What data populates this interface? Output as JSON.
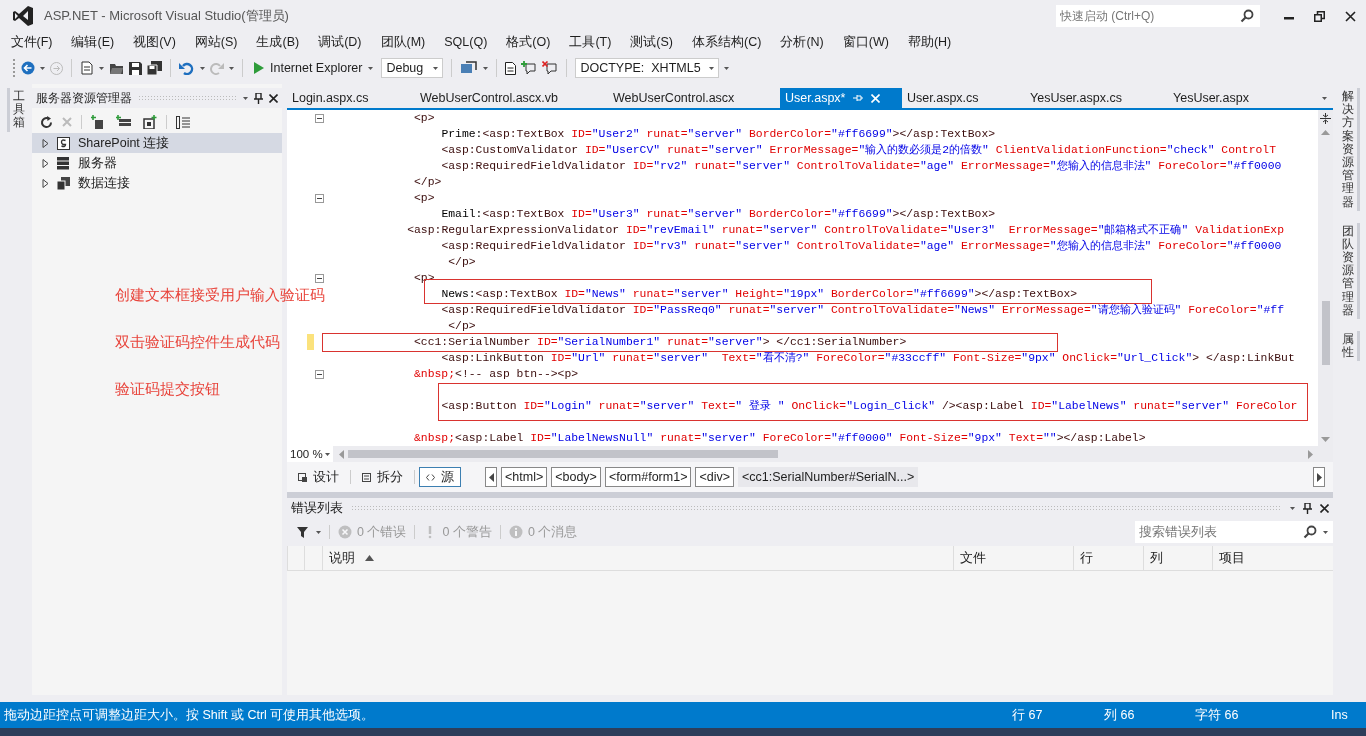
{
  "window": {
    "title": "ASP.NET - Microsoft Visual Studio(管理员)"
  },
  "quick_launch": {
    "placeholder": "快速启动 (Ctrl+Q)"
  },
  "menu": [
    "文件(F)",
    "编辑(E)",
    "视图(V)",
    "网站(S)",
    "生成(B)",
    "调试(D)",
    "团队(M)",
    "SQL(Q)",
    "格式(O)",
    "工具(T)",
    "测试(S)",
    "体系结构(C)",
    "分析(N)",
    "窗口(W)",
    "帮助(H)"
  ],
  "toolbar": {
    "browser": "Internet Explorer",
    "configuration": "Debug",
    "doctype": "DOCTYPE:  XHTML5"
  },
  "left_strip": {
    "tabs": [
      "工具箱"
    ]
  },
  "server_explorer": {
    "title": "服务器资源管理器",
    "tree": [
      {
        "label": "SharePoint 连接",
        "selected": true,
        "expanded": false
      },
      {
        "label": "服务器",
        "selected": false,
        "expanded": false
      },
      {
        "label": "数据连接",
        "selected": false,
        "expanded": false
      }
    ]
  },
  "annotations": [
    "创建文本框接受用户输入验证码",
    "双击验证码控件生成代码",
    "验证码提交按钮"
  ],
  "editor": {
    "tabs": [
      {
        "label": "Login.aspx.cs",
        "selected": false
      },
      {
        "label": "WebUserControl.ascx.vb",
        "selected": false
      },
      {
        "label": "WebUserControl.ascx",
        "selected": false
      },
      {
        "label": "User.aspx*",
        "selected": true
      },
      {
        "label": "User.aspx.cs",
        "selected": false
      },
      {
        "label": "YesUser.aspx.cs",
        "selected": false
      },
      {
        "label": "YesUser.aspx",
        "selected": false
      }
    ],
    "lines": [
      {
        "kind": "code",
        "fold": true,
        "modified": false,
        "segments": [
          {
            "kind": "tag",
            "text": "            <p>"
          }
        ]
      },
      {
        "kind": "code",
        "fold": false,
        "modified": false,
        "segments": [
          {
            "kind": "text",
            "text": "                Prime:"
          },
          {
            "kind": "tag",
            "text": "<asp:TextBox"
          },
          {
            "kind": "attr",
            "text": " ID="
          },
          {
            "kind": "value",
            "text": "\"User2\""
          },
          {
            "kind": "attr",
            "text": " runat="
          },
          {
            "kind": "value",
            "text": "\"server\""
          },
          {
            "kind": "attr",
            "text": " BorderColor="
          },
          {
            "kind": "value",
            "text": "\"#ff6699\""
          },
          {
            "kind": "tag",
            "text": "></asp:TextBox>"
          }
        ]
      },
      {
        "kind": "code",
        "fold": false,
        "modified": false,
        "segments": [
          {
            "kind": "tag",
            "text": "                <asp:CustomValidator"
          },
          {
            "kind": "attr",
            "text": " ID="
          },
          {
            "kind": "value",
            "text": "\"UserCV\""
          },
          {
            "kind": "attr",
            "text": " runat="
          },
          {
            "kind": "value",
            "text": "\"server\""
          },
          {
            "kind": "attr",
            "text": " ErrorMessage="
          },
          {
            "kind": "value",
            "text": "\"输入的数必须是2的倍数\""
          },
          {
            "kind": "attr",
            "text": " ClientValidationFunction="
          },
          {
            "kind": "value",
            "text": "\"check\""
          },
          {
            "kind": "attr",
            "text": " ControlT"
          }
        ]
      },
      {
        "kind": "code",
        "fold": false,
        "modified": false,
        "segments": [
          {
            "kind": "tag",
            "text": "                <asp:RequiredFieldValidator"
          },
          {
            "kind": "attr",
            "text": " ID="
          },
          {
            "kind": "value",
            "text": "\"rv2\""
          },
          {
            "kind": "attr",
            "text": " runat="
          },
          {
            "kind": "value",
            "text": "\"server\""
          },
          {
            "kind": "attr",
            "text": " ControlToValidate="
          },
          {
            "kind": "value",
            "text": "\"age\""
          },
          {
            "kind": "attr",
            "text": " ErrorMessage="
          },
          {
            "kind": "value",
            "text": "\"您输入的信息非法\""
          },
          {
            "kind": "attr",
            "text": " ForeColor="
          },
          {
            "kind": "value",
            "text": "\"#ff0000"
          }
        ]
      },
      {
        "kind": "code",
        "fold": false,
        "modified": false,
        "segments": [
          {
            "kind": "tag",
            "text": "            </p>"
          }
        ]
      },
      {
        "kind": "code",
        "fold": true,
        "modified": false,
        "segments": [
          {
            "kind": "tag",
            "text": "            <p>"
          }
        ]
      },
      {
        "kind": "code",
        "fold": false,
        "modified": false,
        "segments": [
          {
            "kind": "text",
            "text": "                Email:"
          },
          {
            "kind": "tag",
            "text": "<asp:TextBox"
          },
          {
            "kind": "attr",
            "text": " ID="
          },
          {
            "kind": "value",
            "text": "\"User3\""
          },
          {
            "kind": "attr",
            "text": " runat="
          },
          {
            "kind": "value",
            "text": "\"server\""
          },
          {
            "kind": "attr",
            "text": " BorderColor="
          },
          {
            "kind": "value",
            "text": "\"#ff6699\""
          },
          {
            "kind": "tag",
            "text": "></asp:TextBox>"
          }
        ]
      },
      {
        "kind": "code",
        "fold": false,
        "modified": false,
        "segments": [
          {
            "kind": "tag",
            "text": "           <asp:RegularExpressionValidator"
          },
          {
            "kind": "attr",
            "text": " ID="
          },
          {
            "kind": "value",
            "text": "\"revEmail\""
          },
          {
            "kind": "attr",
            "text": " runat="
          },
          {
            "kind": "value",
            "text": "\"server\""
          },
          {
            "kind": "attr",
            "text": " ControlToValidate="
          },
          {
            "kind": "value",
            "text": "\"User3\""
          },
          {
            "kind": "attr",
            "text": "  ErrorMessage="
          },
          {
            "kind": "value",
            "text": "\"邮箱格式不正确\""
          },
          {
            "kind": "attr",
            "text": " ValidationExp"
          }
        ]
      },
      {
        "kind": "code",
        "fold": false,
        "modified": false,
        "segments": [
          {
            "kind": "tag",
            "text": "                <asp:RequiredFieldValidator"
          },
          {
            "kind": "attr",
            "text": " ID="
          },
          {
            "kind": "value",
            "text": "\"rv3\""
          },
          {
            "kind": "attr",
            "text": " runat="
          },
          {
            "kind": "value",
            "text": "\"server\""
          },
          {
            "kind": "attr",
            "text": " ControlToValidate="
          },
          {
            "kind": "value",
            "text": "\"age\""
          },
          {
            "kind": "attr",
            "text": " ErrorMessage="
          },
          {
            "kind": "value",
            "text": "\"您输入的信息非法\""
          },
          {
            "kind": "attr",
            "text": " ForeColor="
          },
          {
            "kind": "value",
            "text": "\"#ff0000"
          }
        ]
      },
      {
        "kind": "code",
        "fold": false,
        "modified": false,
        "segments": [
          {
            "kind": "tag",
            "text": "                 </p>"
          }
        ]
      },
      {
        "kind": "code",
        "fold": true,
        "modified": false,
        "segments": [
          {
            "kind": "tag",
            "text": "            <p>"
          }
        ]
      },
      {
        "kind": "code",
        "fold": false,
        "modified": false,
        "segments": [
          {
            "kind": "text",
            "text": "                News:"
          },
          {
            "kind": "tag",
            "text": "<asp:TextBox"
          },
          {
            "kind": "attr",
            "text": " ID="
          },
          {
            "kind": "value",
            "text": "\"News\""
          },
          {
            "kind": "attr",
            "text": " runat="
          },
          {
            "kind": "value",
            "text": "\"server\""
          },
          {
            "kind": "attr",
            "text": " Height="
          },
          {
            "kind": "value",
            "text": "\"19px\""
          },
          {
            "kind": "attr",
            "text": " BorderColor="
          },
          {
            "kind": "value",
            "text": "\"#ff6699\""
          },
          {
            "kind": "tag",
            "text": "></asp:TextBox>"
          }
        ]
      },
      {
        "kind": "code",
        "fold": false,
        "modified": false,
        "segments": [
          {
            "kind": "tag",
            "text": "                <asp:RequiredFieldValidator"
          },
          {
            "kind": "attr",
            "text": " ID="
          },
          {
            "kind": "value",
            "text": "\"PassReq0\""
          },
          {
            "kind": "attr",
            "text": " runat="
          },
          {
            "kind": "value",
            "text": "\"server\""
          },
          {
            "kind": "attr",
            "text": " ControlToValidate="
          },
          {
            "kind": "value",
            "text": "\"News\""
          },
          {
            "kind": "attr",
            "text": " ErrorMessage="
          },
          {
            "kind": "value",
            "text": "\"请您输入验证码\""
          },
          {
            "kind": "attr",
            "text": " ForeColor="
          },
          {
            "kind": "value",
            "text": "\"#ff"
          }
        ]
      },
      {
        "kind": "code",
        "fold": false,
        "modified": false,
        "segments": [
          {
            "kind": "tag",
            "text": "                 </p>"
          }
        ]
      },
      {
        "kind": "code",
        "fold": false,
        "modified": true,
        "segments": [
          {
            "kind": "tag",
            "text": "            <cc1:SerialNumber"
          },
          {
            "kind": "attr",
            "text": " ID="
          },
          {
            "kind": "value",
            "text": "\"SerialNumber1\""
          },
          {
            "kind": "attr",
            "text": " runat="
          },
          {
            "kind": "value",
            "text": "\"server\""
          },
          {
            "kind": "tag",
            "text": "> </cc1:SerialNumber>"
          }
        ]
      },
      {
        "kind": "code",
        "fold": false,
        "modified": false,
        "segments": [
          {
            "kind": "tag",
            "text": "                <asp:LinkButton"
          },
          {
            "kind": "attr",
            "text": " ID="
          },
          {
            "kind": "value",
            "text": "\"Url\""
          },
          {
            "kind": "attr",
            "text": " runat="
          },
          {
            "kind": "value",
            "text": "\"server\""
          },
          {
            "kind": "attr",
            "text": "  Text="
          },
          {
            "kind": "value",
            "text": "\"看不清?\""
          },
          {
            "kind": "attr",
            "text": " ForeColor="
          },
          {
            "kind": "value",
            "text": "\"#33ccff\""
          },
          {
            "kind": "attr",
            "text": " Font-Size="
          },
          {
            "kind": "value",
            "text": "\"9px\""
          },
          {
            "kind": "attr",
            "text": " OnClick="
          },
          {
            "kind": "value",
            "text": "\"Url_Click\""
          },
          {
            "kind": "tag",
            "text": "> </asp:LinkBut"
          }
        ]
      },
      {
        "kind": "code",
        "fold": true,
        "modified": false,
        "segments": [
          {
            "kind": "entity",
            "text": "            &nbsp;"
          },
          {
            "kind": "tag",
            "text": "<!-- asp btn--><p>"
          }
        ]
      },
      {
        "kind": "blank",
        "fold": false,
        "modified": false
      },
      {
        "kind": "code",
        "fold": false,
        "modified": false,
        "segments": [
          {
            "kind": "tag",
            "text": "                <asp:Button"
          },
          {
            "kind": "attr",
            "text": " ID="
          },
          {
            "kind": "value",
            "text": "\"Login\""
          },
          {
            "kind": "attr",
            "text": " runat="
          },
          {
            "kind": "value",
            "text": "\"server\""
          },
          {
            "kind": "attr",
            "text": " Text="
          },
          {
            "kind": "value",
            "text": "\" 登录 \""
          },
          {
            "kind": "attr",
            "text": " OnClick="
          },
          {
            "kind": "value",
            "text": "\"Login_Click\""
          },
          {
            "kind": "tag",
            "text": " /><asp:Label"
          },
          {
            "kind": "attr",
            "text": " ID="
          },
          {
            "kind": "value",
            "text": "\"LabelNews\""
          },
          {
            "kind": "attr",
            "text": " runat="
          },
          {
            "kind": "value",
            "text": "\"server\""
          },
          {
            "kind": "attr",
            "text": " ForeColor"
          }
        ]
      },
      {
        "kind": "blank",
        "fold": false,
        "modified": false
      },
      {
        "kind": "code",
        "fold": false,
        "modified": false,
        "segments": [
          {
            "kind": "entity",
            "text": "            &nbsp;"
          },
          {
            "kind": "tag",
            "text": "<asp:Label"
          },
          {
            "kind": "attr",
            "text": " ID="
          },
          {
            "kind": "value",
            "text": "\"LabelNewsNull\""
          },
          {
            "kind": "attr",
            "text": " runat="
          },
          {
            "kind": "value",
            "text": "\"server\""
          },
          {
            "kind": "attr",
            "text": " ForeColor="
          },
          {
            "kind": "value",
            "text": "\"#ff0000\""
          },
          {
            "kind": "attr",
            "text": " Font-Size="
          },
          {
            "kind": "value",
            "text": "\"9px\""
          },
          {
            "kind": "attr",
            "text": " Text="
          },
          {
            "kind": "value",
            "text": "\"\""
          },
          {
            "kind": "tag",
            "text": "></asp:Label>"
          }
        ]
      }
    ],
    "zoom": "100 %",
    "views": [
      {
        "label": "设计",
        "selected": false
      },
      {
        "label": "拆分",
        "selected": false
      },
      {
        "label": "源",
        "selected": true
      }
    ],
    "breadcrumb": [
      {
        "label": "<html>",
        "selected": false
      },
      {
        "label": "<body>",
        "selected": false
      },
      {
        "label": "<form#form1>",
        "selected": false
      },
      {
        "label": "<div>",
        "selected": false
      },
      {
        "label": "<cc1:SerialNumber#SerialN...>",
        "selected": true
      }
    ]
  },
  "error_list": {
    "title": "错误列表",
    "filters": [
      {
        "label": "0 个错误",
        "kind": "error",
        "disabled": true
      },
      {
        "label": "0 个警告",
        "kind": "warning",
        "disabled": true
      },
      {
        "label": "0 个消息",
        "kind": "message",
        "disabled": true
      }
    ],
    "search": {
      "placeholder": "搜索错误列表"
    },
    "columns": [
      {
        "label": "说明",
        "sorted": true
      },
      {
        "label": "文件",
        "sorted": false
      },
      {
        "label": "行",
        "sorted": false
      },
      {
        "label": "列",
        "sorted": false
      },
      {
        "label": "项目",
        "sorted": false
      }
    ]
  },
  "right_strip": {
    "tabs": [
      "解决方案资源管理器",
      "团队资源管理器",
      "属性"
    ]
  },
  "status_bar": {
    "message": "拖动边距控点可调整边距大小。按 Shift 或 Ctrl 可使用其他选项。",
    "line": "行 67",
    "column": "列 66",
    "character": "字符 66",
    "mode": "Ins"
  }
}
